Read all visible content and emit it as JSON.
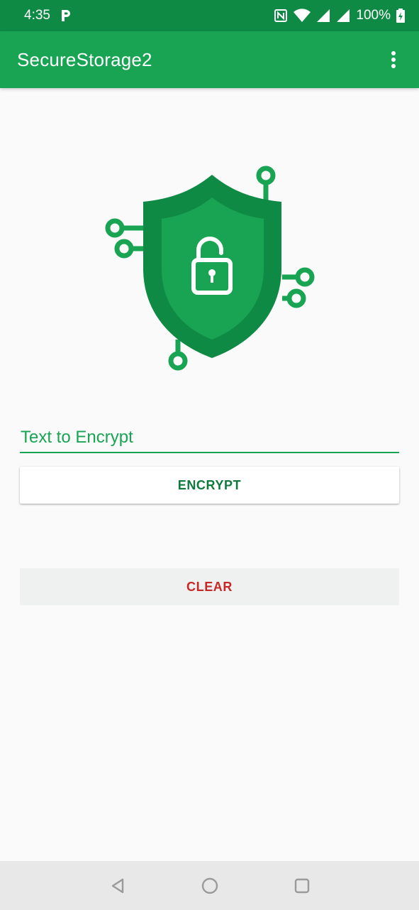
{
  "status_bar": {
    "time": "4:35",
    "notification_icon": "parking-p-icon",
    "battery_text": "100%",
    "icons": [
      "nfc-icon",
      "wifi-icon",
      "signal-icon",
      "signal-icon",
      "battery-charging-icon"
    ]
  },
  "app_bar": {
    "title": "SecureStorage2",
    "menu_icon": "overflow-menu-icon"
  },
  "hero": {
    "icon": "shield-unlocked-circuit-icon",
    "colors": {
      "shield_outer": "#0f8a45",
      "shield_inner": "#18a453",
      "lock": "#ffffff"
    }
  },
  "form": {
    "input_placeholder": "Text to Encrypt",
    "input_value": "",
    "encrypt_label": "ENCRYPT",
    "clear_label": "CLEAR"
  },
  "nav_bar": {
    "back_icon": "back-triangle-icon",
    "home_icon": "home-circle-icon",
    "recents_icon": "recents-square-icon"
  },
  "colors": {
    "primary": "#18a453",
    "primary_dark": "#0f8a45",
    "clear_text": "#c62828",
    "encrypt_text": "#0f7a3c"
  }
}
